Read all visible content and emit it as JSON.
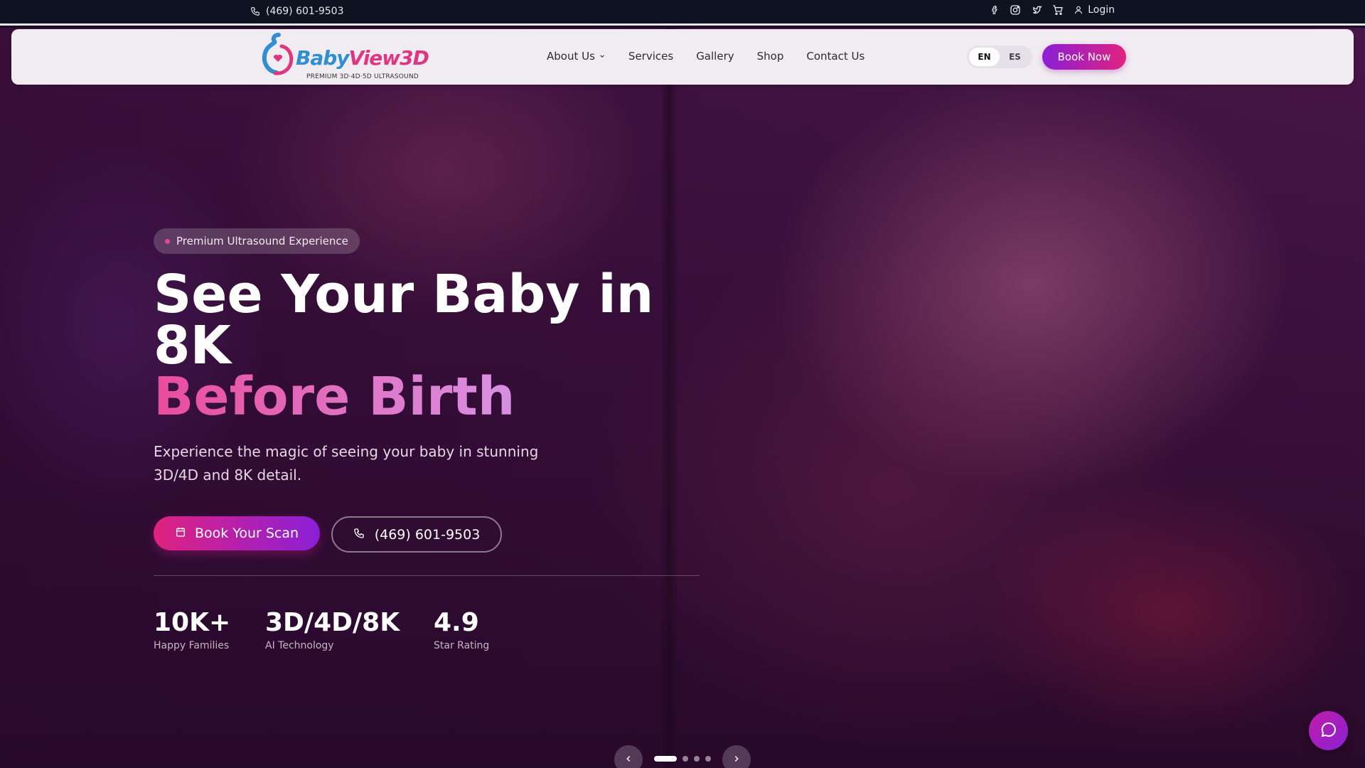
{
  "topbar": {
    "phone": "(469) 601-9503",
    "social_icons": [
      "facebook-icon",
      "instagram-icon",
      "twitter-icon"
    ],
    "cart_icon": "cart-icon",
    "login_label": "Login"
  },
  "nav": {
    "logo": {
      "wordmark_part1": "Baby",
      "wordmark_part2": "View3D",
      "tagline": "PREMIUM 3D·4D·5D ULTRASOUND"
    },
    "menu": [
      {
        "label": "About Us",
        "has_dropdown": true
      },
      {
        "label": "Services"
      },
      {
        "label": "Gallery"
      },
      {
        "label": "Shop"
      },
      {
        "label": "Contact Us"
      }
    ],
    "languages": [
      "EN",
      "ES"
    ],
    "active_language": "EN",
    "book_now_label": "Book Now"
  },
  "hero": {
    "badge": "Premium Ultrasound Experience",
    "headline_line1": "See Your Baby in",
    "headline_line2": "8K",
    "headline_highlight": "Before Birth",
    "subtitle": "Experience the magic of seeing your baby in stunning 3D/4D and 8K detail.",
    "cta_primary": "Book Your Scan",
    "cta_phone": "(469) 601-9503",
    "stats": [
      {
        "value": "10K+",
        "label": "Happy Families"
      },
      {
        "value": "3D/4D/8K",
        "label": "AI Technology"
      },
      {
        "value": "4.9",
        "label": "Star Rating"
      }
    ]
  },
  "carousel": {
    "slide_count": 4,
    "active_index": 0
  },
  "colors": {
    "accent_pink": "#e0227f",
    "accent_purple": "#8b1fd6",
    "topbar_bg": "#0d1320",
    "nav_bg": "#f1ecf1"
  }
}
